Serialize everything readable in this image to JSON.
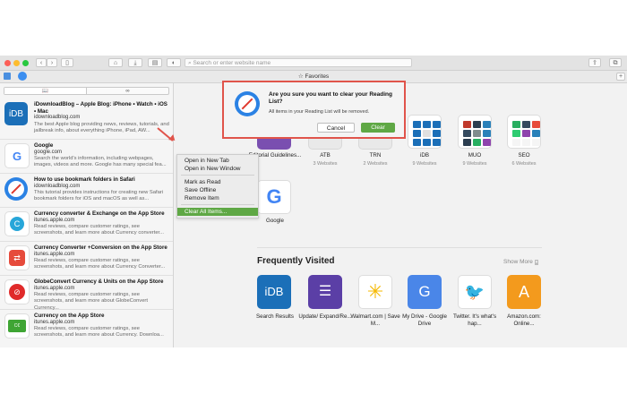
{
  "toolbar": {
    "address_placeholder": "Search or enter website name",
    "nav_back": "‹",
    "nav_forward": "›"
  },
  "favbar": {
    "title": "Favorites"
  },
  "sidebar": {
    "items": [
      {
        "title": "iDownloadBlog – Apple Blog: iPhone • Watch • iOS • Mac",
        "url": "idownloadblog.com",
        "desc": "The best Apple blog providing news, reviews, tutorials, and jailbreak info, about everything iPhone, iPad, AW..."
      },
      {
        "title": "Google",
        "url": "google.com",
        "desc": "Search the world's information, including webpages, images, videos and more. Google has many special fea..."
      },
      {
        "title": "How to use bookmark folders in Safari",
        "url": "idownloadblog.com",
        "desc": "This tutorial provides instructions for creating new Safari bookmark folders for iOS and macOS as well as..."
      },
      {
        "title": "Currency converter & Exchange on the App Store",
        "url": "itunes.apple.com",
        "desc": "Read reviews, compare customer ratings, see screenshots, and learn more about Currency converter..."
      },
      {
        "title": "Currency Converter +Conversion on the App Store",
        "url": "itunes.apple.com",
        "desc": "Read reviews, compare customer ratings, see screenshots, and learn more about Currency Converter..."
      },
      {
        "title": "GlobeConvert Currency & Units on the App Store",
        "url": "itunes.apple.com",
        "desc": "Read reviews, compare customer ratings, see screenshots, and learn more about GlobeConvert Currency..."
      },
      {
        "title": "Currency on the App Store",
        "url": "itunes.apple.com",
        "desc": "Read reviews, compare customer ratings, see screenshots, and learn more about Currency. Downloa..."
      }
    ]
  },
  "context_menu": {
    "open_new_tab": "Open in New Tab",
    "open_new_window": "Open in New Window",
    "mark_as_read": "Mark as Read",
    "save_offline": "Save Offline",
    "remove_item": "Remove Item",
    "clear_all": "Clear All Items..."
  },
  "dialog": {
    "title": "Are you sure you want to clear your Reading List?",
    "message": "All items in your Reading List will be removed.",
    "cancel": "Cancel",
    "clear": "Clear"
  },
  "favorites": [
    {
      "label": "Editorial Guidelines...",
      "sub": ""
    },
    {
      "label": "ATB",
      "sub": "3 Websites"
    },
    {
      "label": "TRN",
      "sub": "2 Websites"
    },
    {
      "label": "iDB",
      "sub": "9 Websites"
    },
    {
      "label": "MUO",
      "sub": "9 Websites"
    },
    {
      "label": "SEO",
      "sub": "6 Websites"
    },
    {
      "label": "Google",
      "sub": ""
    }
  ],
  "frequently_visited": {
    "heading": "Frequently Visited",
    "show_more": "Show More",
    "items": [
      {
        "label": "Search Results",
        "glyph": "iDB"
      },
      {
        "label": "Update/ Expand/Re...",
        "glyph": "☰"
      },
      {
        "label": "Walmart.com | Save M...",
        "glyph": "✳"
      },
      {
        "label": "My Drive - Google Drive",
        "glyph": "G"
      },
      {
        "label": "Twitter. It's what's hap...",
        "glyph": "🐦"
      },
      {
        "label": "Amazon.com: Online...",
        "glyph": "A"
      }
    ]
  },
  "icons": {
    "reading_list": "📖",
    "shared_links": "∞",
    "star": "☆"
  },
  "colors": {
    "highlight": "#e0544b",
    "accent_green": "#5fa845"
  }
}
